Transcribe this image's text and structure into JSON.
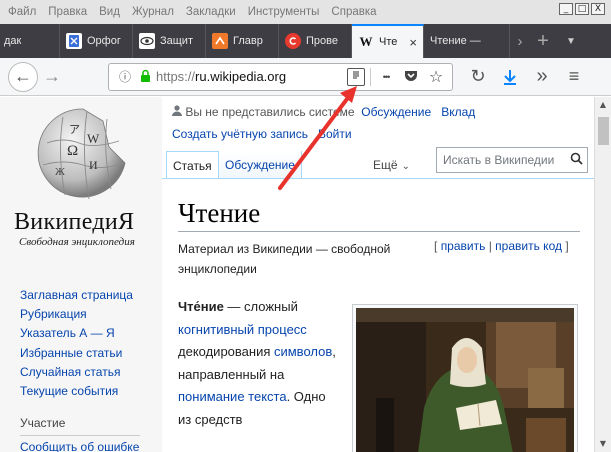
{
  "menu": [
    "Файл",
    "Правка",
    "Вид",
    "Журнал",
    "Закладки",
    "Инструменты",
    "Справка"
  ],
  "window_controls": {
    "minimize": "_",
    "maximize": "□",
    "close": "X"
  },
  "tabs": [
    {
      "label": "дак",
      "icon": "tab-generic-icon"
    },
    {
      "label": "Орфог",
      "icon": "orthography-icon"
    },
    {
      "label": "Защит",
      "icon": "eye-icon"
    },
    {
      "label": "Главр",
      "icon": "glavred-icon"
    },
    {
      "label": "Прове",
      "icon": "copyright-icon"
    },
    {
      "label": "Чте",
      "icon": "wikipedia-w-icon",
      "active": true,
      "close": "×"
    },
    {
      "label": "Чтение —",
      "icon": "none"
    }
  ],
  "tab_controls": {
    "next": "›",
    "new_tab": "+",
    "list": "▼"
  },
  "url": {
    "scheme": "https://",
    "host": "ru.wikipedia.org"
  },
  "toolbar": {
    "more": "•••",
    "back": "←",
    "forward": "→",
    "reload": "↻",
    "download": "↓",
    "overflow": "»",
    "menu": "≡",
    "star": "☆",
    "pocket": "⌄"
  },
  "sidebar": {
    "wordmark": "ВикипедиЯ",
    "tagline": "Свободная энциклопедия",
    "nav": [
      "Заглавная страница",
      "Рубрикация",
      "Указатель А — Я",
      "Избранные статьи",
      "Случайная статья",
      "Текущие события"
    ],
    "section_heading": "Участие",
    "section_first": "Сообщить об ошибке"
  },
  "personal": {
    "anon": "Вы не представились системе",
    "talk": "Обсуждение",
    "contrib": "Вклад",
    "create": "Создать учётную запись",
    "login": "Войти"
  },
  "page_tabs": {
    "article": "Статья",
    "talk": "Обсуждение",
    "more": "Ещё"
  },
  "search": {
    "placeholder": "Искать в Википедии",
    "button": "Q"
  },
  "article": {
    "title": "Чтение",
    "subtitle": "Материал из Википедии — свободной энциклопедии",
    "edit_open": "[",
    "edit": "править",
    "edit_sep": "|",
    "edit_code": "править код",
    "edit_close": "]",
    "para": {
      "bold": "Чте́ние",
      "t1": " — сложный ",
      "l1": "когнитивный процесс",
      "t2": " декодирования ",
      "l2": "символов",
      "t3": ", направленный на ",
      "l3": "понимание текста",
      "t4": ". Одно из средств"
    }
  },
  "colors": {
    "link": "#0645ad",
    "accent": "#0a84ff",
    "arrow": "#e8322c",
    "tabstrip": "#3d3d43"
  }
}
